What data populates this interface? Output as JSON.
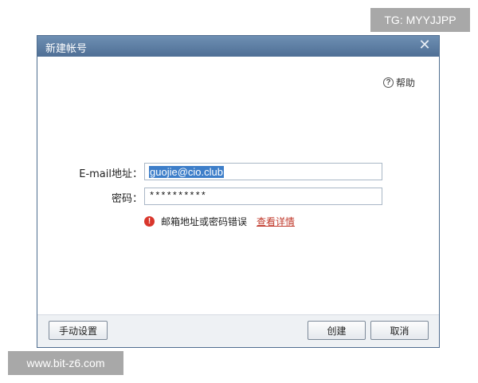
{
  "watermarks": {
    "top_right": "TG: MYYJJPP",
    "bottom_left": "www.bit-z6.com"
  },
  "dialog": {
    "title": "新建帐号",
    "close_symbol": "✕",
    "help_label": "帮助",
    "help_icon": "question-circle-icon",
    "email_label": "E-mail地址：",
    "email_value": "guojie@cio.club",
    "password_label": "密码：",
    "password_value": "**********",
    "error_icon": "exclamation-circle-icon",
    "error_text": "邮箱地址或密码错误",
    "error_link": "查看详情",
    "manual_button": "手动设置",
    "create_button": "创建",
    "cancel_button": "取消"
  },
  "colors": {
    "titlebar": "#5a7aa1",
    "selection": "#3d7ec9",
    "error": "#d9362c",
    "link": "#c0392b"
  }
}
